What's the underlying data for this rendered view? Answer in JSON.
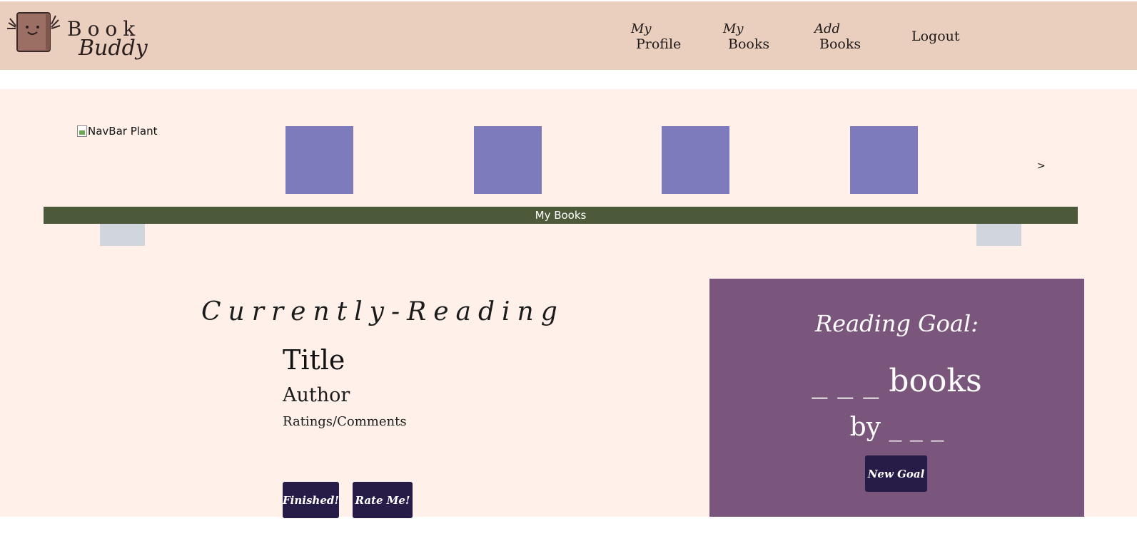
{
  "header": {
    "logo_word1": "Book",
    "logo_word2": "Buddy",
    "nav": [
      {
        "small": "My",
        "big": "Profile"
      },
      {
        "small": "My",
        "big": "Books"
      },
      {
        "small": "Add",
        "big": "Books"
      }
    ],
    "logout": "Logout"
  },
  "shelf": {
    "plant_alt": "NavBar Plant",
    "book_color": "#7d7bbb",
    "next_label": ">",
    "board_label": "My Books",
    "board_color": "#4c5a39"
  },
  "currently_reading": {
    "heading": "Currently-Reading",
    "title": "Title",
    "author": "Author",
    "ratings": "Ratings/Comments",
    "finished_button": "Finished!",
    "rate_button": "Rate Me!"
  },
  "goal": {
    "heading": "Reading Goal:",
    "books_line": "_ _ _ books",
    "by_line": "by _ _ _",
    "new_goal_button": "New Goal",
    "panel_color": "#7b567c"
  },
  "colors": {
    "header_bg": "#eacebe",
    "page_bg": "#fff1e9",
    "button_bg": "#271b47"
  }
}
